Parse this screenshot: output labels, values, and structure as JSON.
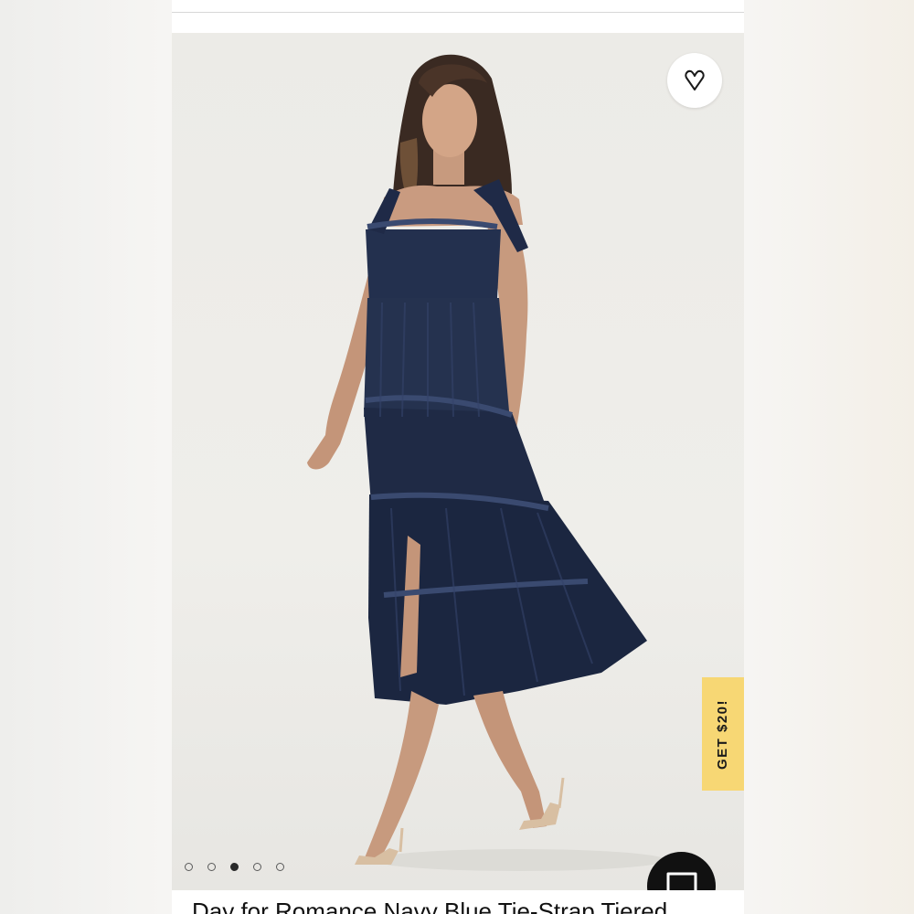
{
  "product": {
    "title": "Day for Romance Navy Blue Tie-Strap Tiered"
  },
  "gallery": {
    "image_count": 5,
    "active_index": 2,
    "image_alt": "Model wearing navy blue tie-strap tiered midi dress with ruffle trim and nude strappy heels"
  },
  "promo": {
    "label": "GET $20!",
    "color": "#f7d774"
  },
  "icons": {
    "wishlist": "heart-icon",
    "chat": "chat-bubble-icon"
  },
  "colors": {
    "dress": "#1e2a44",
    "background": "#ecebe7",
    "chat_button": "#111111"
  }
}
